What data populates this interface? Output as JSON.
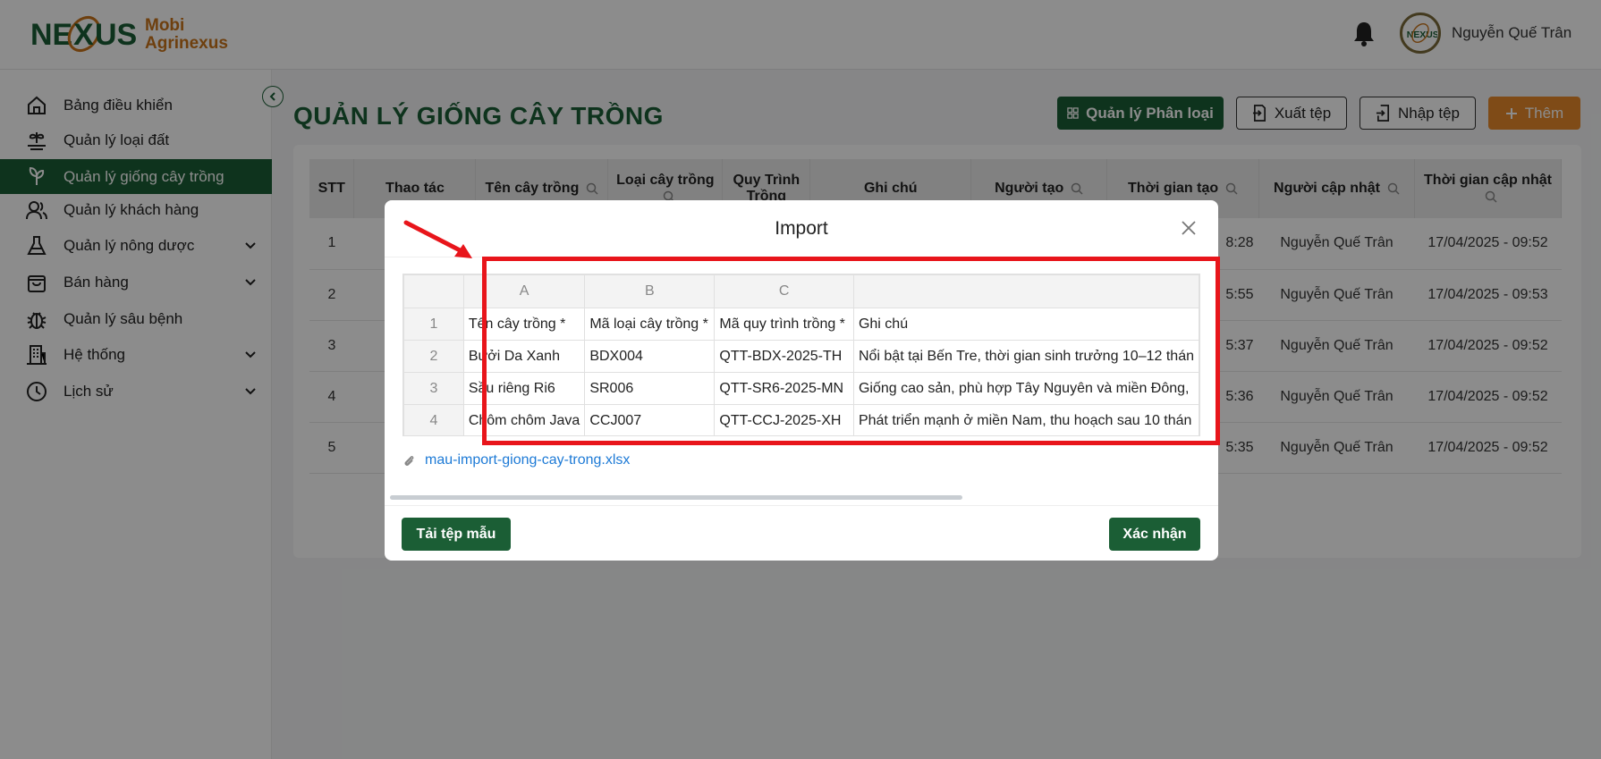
{
  "header": {
    "brand_line1": "Mobi",
    "brand_line2": "Agrinexus",
    "username": "Nguyễn Quế Trân"
  },
  "sidebar": {
    "items": [
      {
        "label": "Bảng điều khiển",
        "icon": "home-icon",
        "active": false,
        "expandable": false
      },
      {
        "label": "Quản lý loại đất",
        "icon": "soil-icon",
        "active": false,
        "expandable": false
      },
      {
        "label": "Quản lý giống cây trồng",
        "icon": "plant-icon",
        "active": true,
        "expandable": false
      },
      {
        "label": "Quản lý khách hàng",
        "icon": "users-icon",
        "active": false,
        "expandable": false
      },
      {
        "label": "Quản lý nông dược",
        "icon": "flask-icon",
        "active": false,
        "expandable": true
      },
      {
        "label": "Bán hàng",
        "icon": "bag-icon",
        "active": false,
        "expandable": true
      },
      {
        "label": "Quản lý sâu bệnh",
        "icon": "bug-icon",
        "active": false,
        "expandable": false
      },
      {
        "label": "Hệ thống",
        "icon": "building-icon",
        "active": false,
        "expandable": true
      },
      {
        "label": "Lịch sử",
        "icon": "clock-icon",
        "active": false,
        "expandable": true
      }
    ]
  },
  "page": {
    "title": "QUẢN LÝ GIỐNG CÂY TRỒNG",
    "buttons": {
      "categories": "Quản lý Phân loại",
      "export": "Xuất tệp",
      "import": "Nhập tệp",
      "add": "Thêm"
    }
  },
  "grid": {
    "headers": [
      "STT",
      "Thao tác",
      "Tên cây trồng",
      "Loại cây trồng",
      "Quy Trình Trồng",
      "Ghi chú",
      "Người tạo",
      "Thời gian tạo",
      "Người cập nhật",
      "Thời gian cập nhật"
    ],
    "rows": [
      {
        "stt": "1",
        "created_time_tail": "8:28",
        "updater": "Nguyễn Quế Trân",
        "updated_time": "17/04/2025 - 09:52"
      },
      {
        "stt": "2",
        "created_time_tail": "5:55",
        "updater": "Nguyễn Quế Trân",
        "updated_time": "17/04/2025 - 09:53"
      },
      {
        "stt": "3",
        "created_time_tail": "5:37",
        "updater": "Nguyễn Quế Trân",
        "updated_time": "17/04/2025 - 09:52"
      },
      {
        "stt": "4",
        "created_time_tail": "5:36",
        "updater": "Nguyễn Quế Trân",
        "updated_time": "17/04/2025 - 09:52"
      },
      {
        "stt": "5",
        "created_time_tail": "5:35",
        "updater": "Nguyễn Quế Trân",
        "updated_time": "17/04/2025 - 09:52"
      }
    ]
  },
  "modal": {
    "title": "Import",
    "columns": [
      "A",
      "B",
      "C",
      ""
    ],
    "rows": [
      {
        "num": "1",
        "cells": [
          "Tên cây trồng *",
          "Mã loại cây trồng *",
          "Mã quy trình trồng *",
          "Ghi chú"
        ]
      },
      {
        "num": "2",
        "cells": [
          "Bưởi Da Xanh",
          "BDX004",
          "QTT-BDX-2025-TH",
          "Nổi bật tại Bến Tre, thời gian sinh trưởng 10–12 thán"
        ]
      },
      {
        "num": "3",
        "cells": [
          "Sầu riêng Ri6",
          "SR006",
          "QTT-SR6-2025-MN",
          "Giống cao sản, phù hợp Tây Nguyên và miền Đông,"
        ]
      },
      {
        "num": "4",
        "cells": [
          "Chôm chôm Java",
          "CCJ007",
          "QTT-CCJ-2025-XH",
          "Phát triển mạnh ở miền Nam, thu hoạch sau 10 thán"
        ]
      }
    ],
    "file_name": "mau-import-giong-cay-trong.xlsx",
    "download_template": "Tải tệp mẫu",
    "confirm": "Xác nhận"
  },
  "colors": {
    "primary_green": "#1b5e35",
    "accent_orange": "#e8892a",
    "annotation_red": "#e8151b",
    "link_blue": "#1d7ad6"
  }
}
